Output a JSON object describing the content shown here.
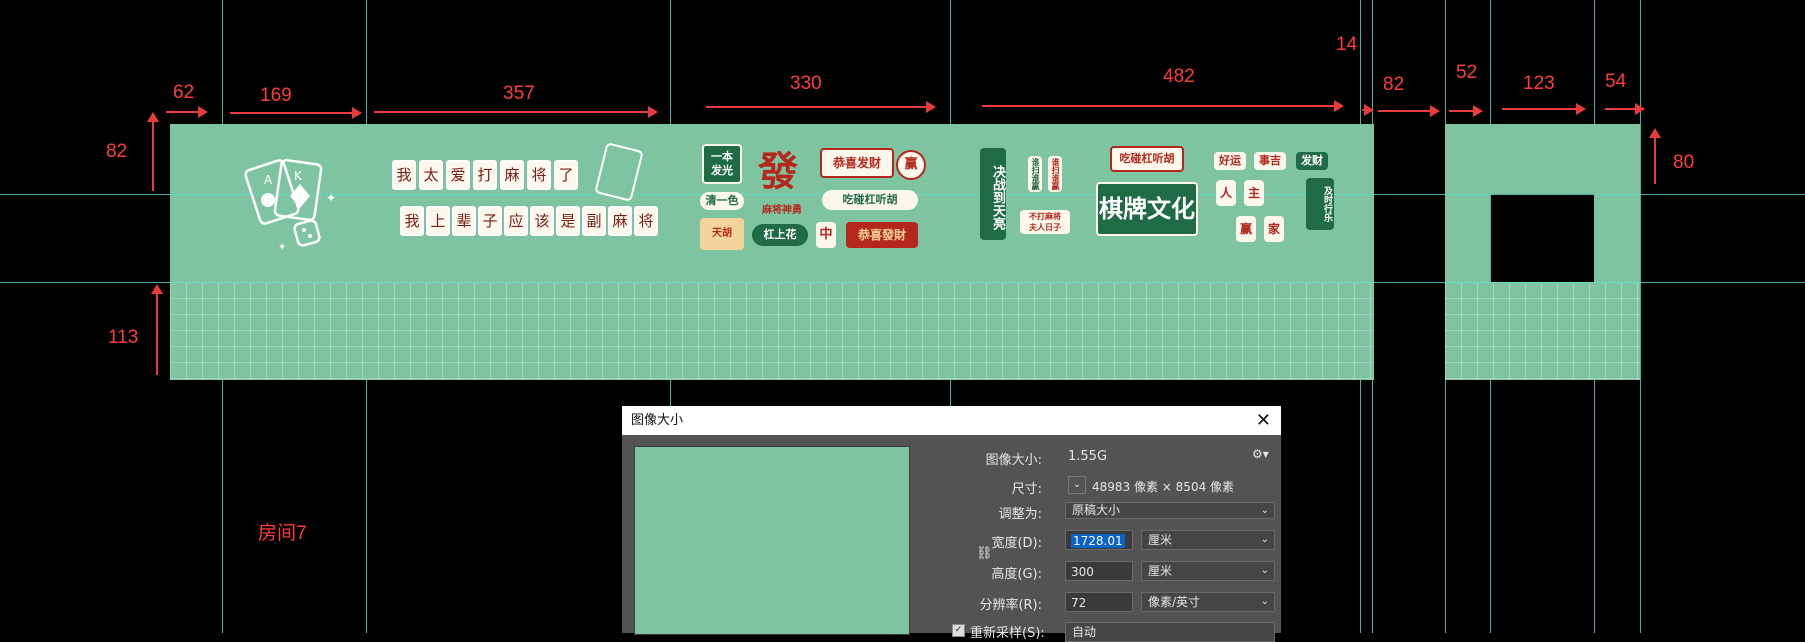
{
  "dimensions": {
    "top": [
      "62",
      "169",
      "357",
      "330",
      "482",
      "14",
      "82",
      "52",
      "123",
      "54"
    ],
    "left_82": "82",
    "left_113": "113",
    "right_80": "80"
  },
  "room_label": "房间7",
  "artwork": {
    "tiles_row1": [
      "我",
      "太",
      "爱",
      "打",
      "麻",
      "将",
      "了"
    ],
    "tiles_row2": [
      "我",
      "上",
      "辈",
      "子",
      "应",
      "该",
      "是",
      "副",
      "麻",
      "将"
    ],
    "cards": [
      "A",
      "K"
    ],
    "badges": {
      "yiben": "一本\n发光",
      "fa": "發",
      "fa_sub": "麻将神勇",
      "gongxi": "恭喜发财",
      "ying": "赢",
      "qingyise": "清一色",
      "chipeng": "吃碰杠听胡",
      "tianhu": "天胡",
      "gangshanghua": "杠上花",
      "zhong": "中",
      "zhufeng": "恭喜發財",
      "juezhan": "决战到天亮",
      "zuichi": "谁扫谁赢",
      "xiaobang": "不打麻将\n夫人日子",
      "chipeng2": "吃碰杠听胡",
      "qipai": "棋牌文化",
      "haoyun": "好运",
      "shi": "事吉",
      "facai": "发财",
      "ren": "人",
      "zhu": "主",
      "ying2": "赢",
      "jia": "家",
      "jishi": "及时行乐"
    }
  },
  "dialog": {
    "title": "图像大小",
    "image_size_label": "图像大小:",
    "image_size_value": "1.55G",
    "dims_label": "尺寸:",
    "dims_value": "48983 像素 × 8504 像素",
    "fit_label": "调整为:",
    "fit_value": "原稿大小",
    "width_label": "宽度(D):",
    "width_value": "1728.01",
    "width_unit": "厘米",
    "height_label": "高度(G):",
    "height_value": "300",
    "height_unit": "厘米",
    "res_label": "分辨率(R):",
    "res_value": "72",
    "res_unit": "像素/英寸",
    "resample_label": "重新采样(S):",
    "resample_value": "自动"
  },
  "colors": {
    "mint": "#7ec4a0",
    "guide": "#59d9d4",
    "dim_red": "#ff3b3b",
    "dark_green": "#1f6b45",
    "red": "#b5271c"
  }
}
